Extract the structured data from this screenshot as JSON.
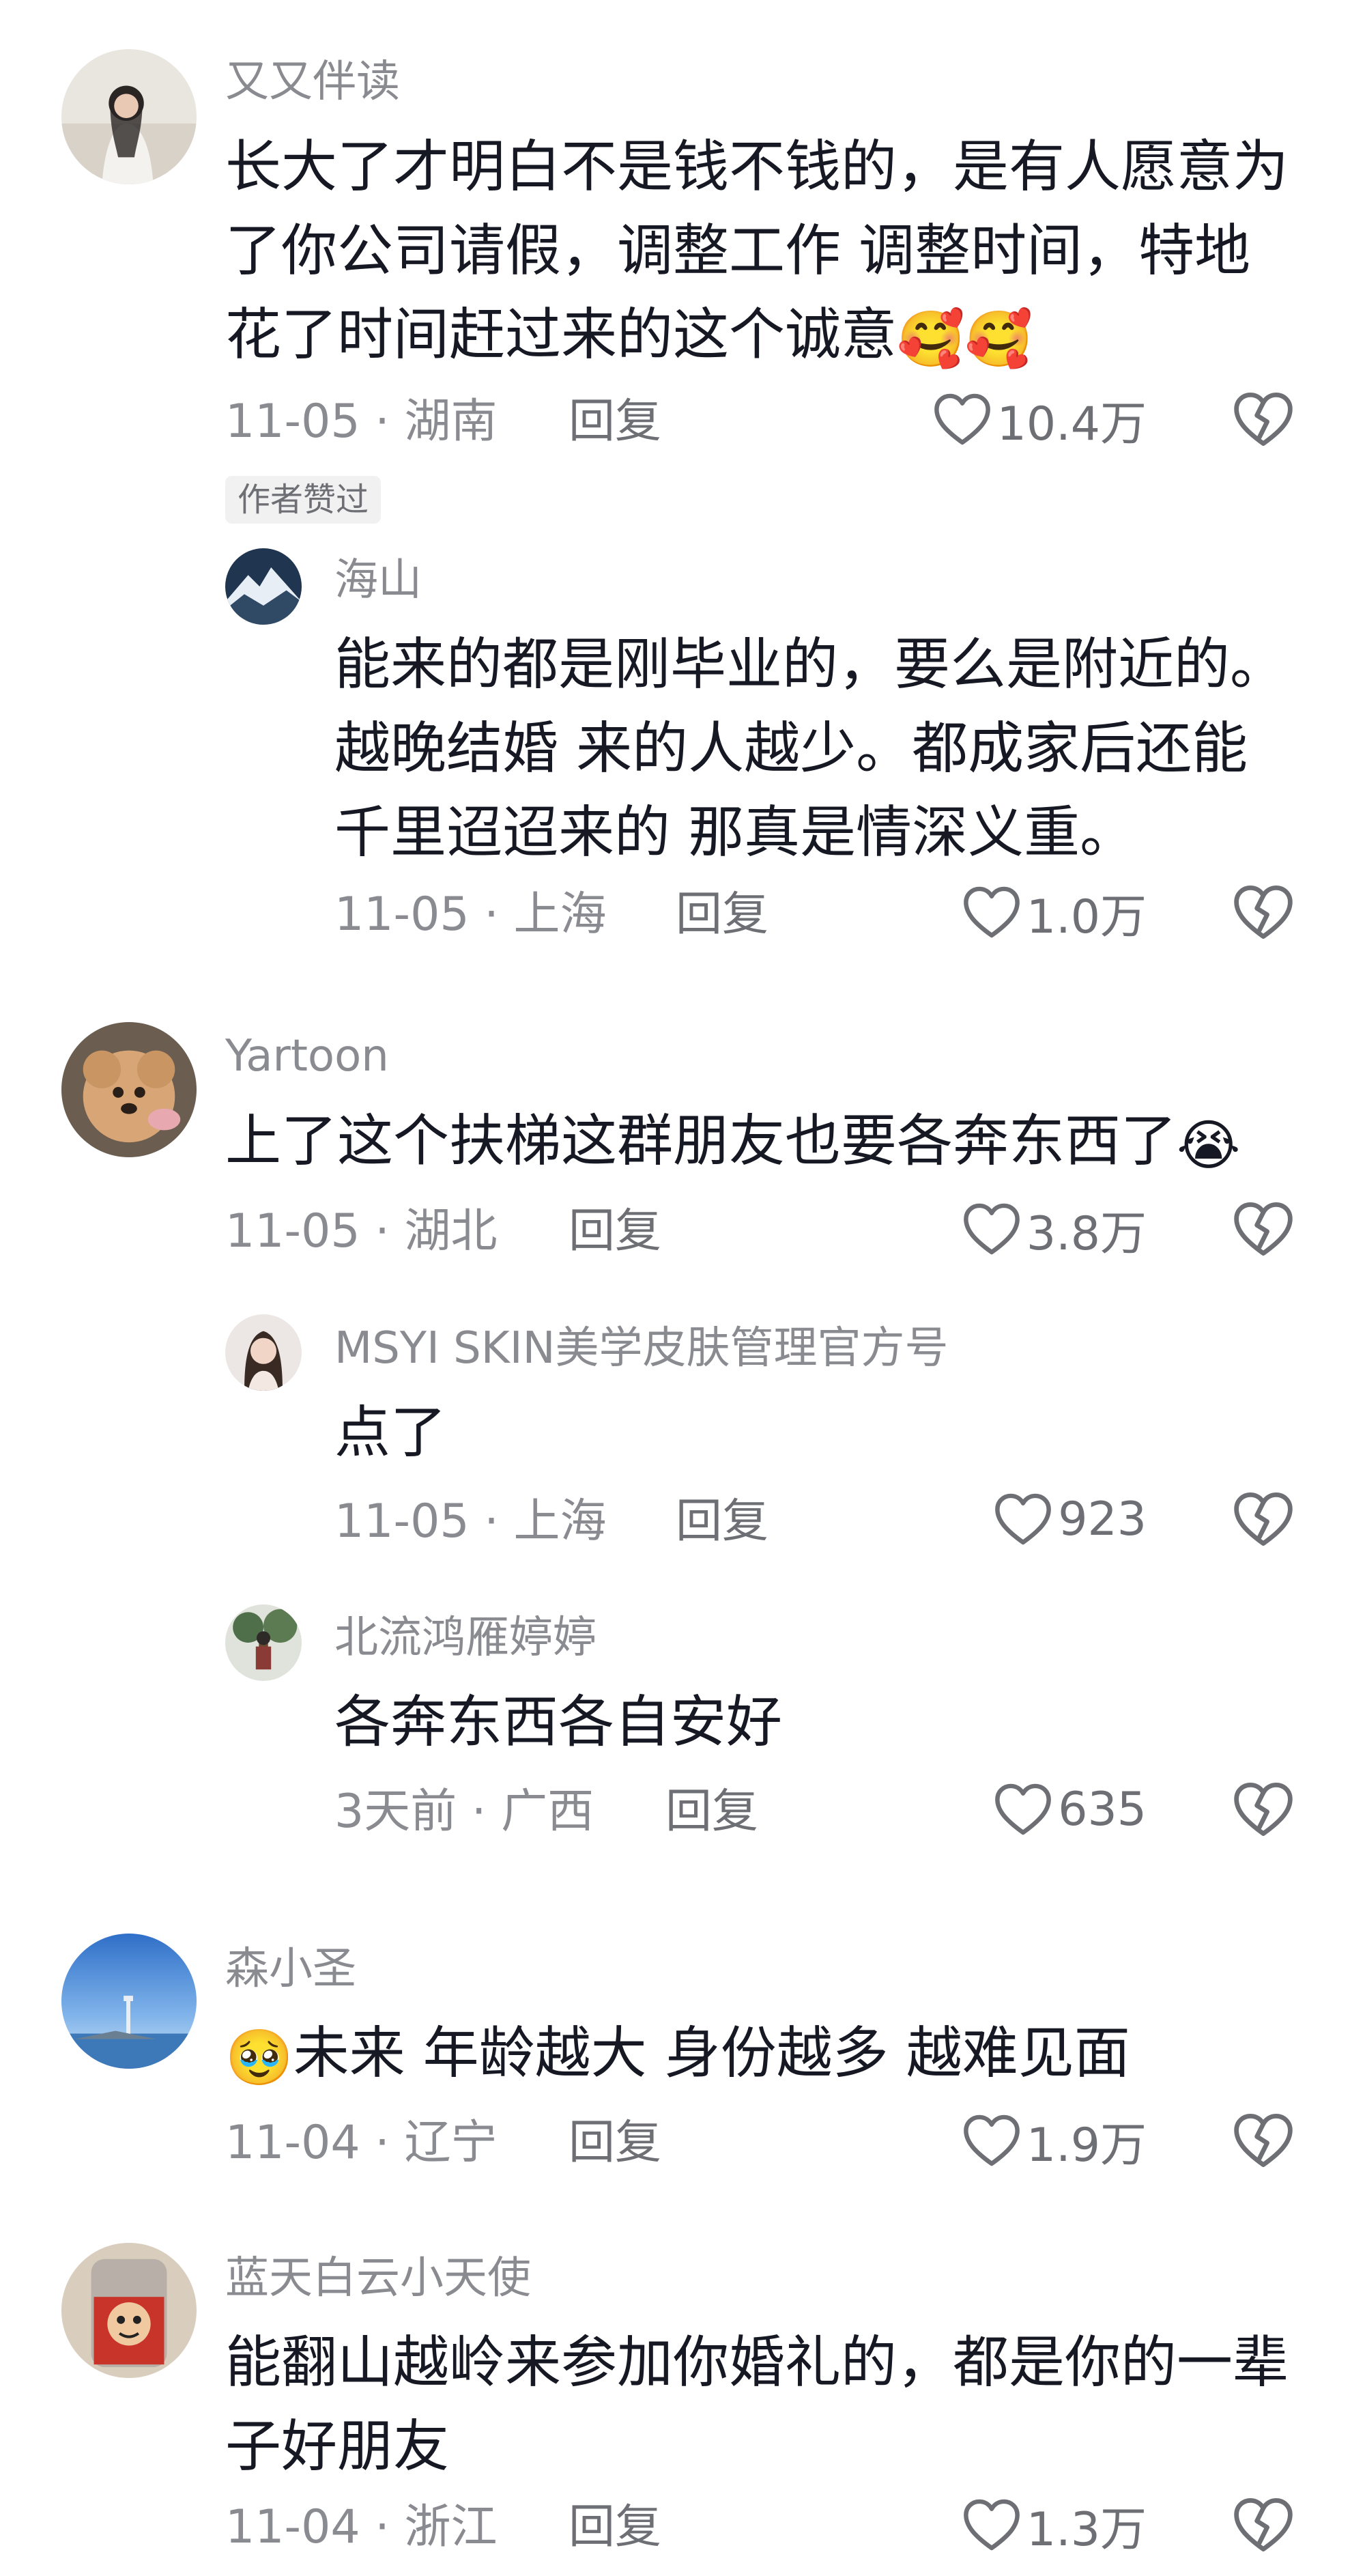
{
  "comments": [
    {
      "username": "又又伴读",
      "text": "长大了才明白不是钱不钱的，是有人愿意为了你公司请假，调整工作 调整时间，特地花了时间赶过来的这个诚意",
      "emoji": "🥰🥰",
      "meta": "11-05 · 湖南",
      "reply": "回复",
      "likes": "10.4万",
      "badge": "作者赞过"
    },
    {
      "username": "海山",
      "text": "能来的都是刚毕业的，要么是附近的。越晚结婚 来的人越少。都成家后还能千里迢迢来的 那真是情深义重。",
      "meta": "11-05 · 上海",
      "reply": "回复",
      "likes": "1.0万"
    },
    {
      "username": "Yartoon",
      "text": "上了这个扶梯这群朋友也要各奔东西了",
      "emoji": "😭",
      "meta": "11-05 · 湖北",
      "reply": "回复",
      "likes": "3.8万"
    },
    {
      "username": "MSYI SKIN美学皮肤管理官方号",
      "text": "点了",
      "meta": "11-05 · 上海",
      "reply": "回复",
      "likes": "923"
    },
    {
      "username": "北流鸿雁婷婷",
      "text": "各奔东西各自安好",
      "meta": "3天前 · 广西",
      "reply": "回复",
      "likes": "635"
    },
    {
      "username": "森小圣",
      "emoji": "🥹",
      "text": "未来 年龄越大 身份越多 越难见面",
      "meta": "11-04 · 辽宁",
      "reply": "回复",
      "likes": "1.9万"
    },
    {
      "username": "蓝天白云小天使",
      "text": "能翻山越岭来参加你婚礼的，都是你的一辈子好朋友",
      "meta": "11-04 · 浙江",
      "reply": "回复",
      "likes": "1.3万"
    }
  ],
  "icons": {
    "like": "heart-outline-icon",
    "dislike": "broken-heart-icon"
  },
  "colors": {
    "text": "#161823",
    "muted": "#8a8b91",
    "action": "#6e6f75"
  }
}
